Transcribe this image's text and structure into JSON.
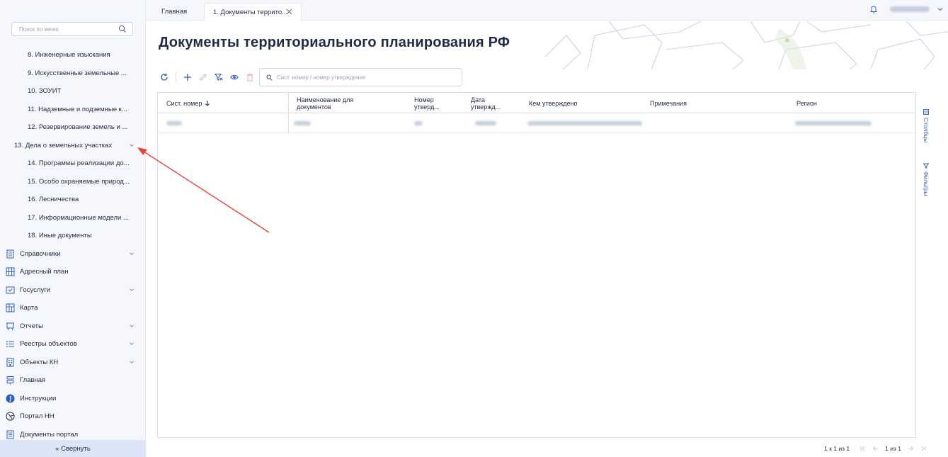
{
  "sidebar": {
    "search_placeholder": "Поиск по меню",
    "sub_items": [
      "8. Инженерные изыскания",
      "9. Искусственные земельные ...",
      "10. ЗОУИТ",
      "11. Надземные и подземные к...",
      "12. Резервирование земель и ..."
    ],
    "group_item": "13. Дела о земельных участках",
    "sub_items_after": [
      "14. Программы реализации до...",
      "15. Особо охраняемые природ...",
      "16. Лесничества",
      "17. Информационные модели ...",
      "18. Иные документы"
    ],
    "top_items": [
      {
        "label": "Справочники",
        "icon": "book-icon",
        "chevron": true
      },
      {
        "label": "Адресный план",
        "icon": "map-grid-icon",
        "chevron": false
      },
      {
        "label": "Госуслуги",
        "icon": "inbox-check-icon",
        "chevron": true
      },
      {
        "label": "Карта",
        "icon": "map-icon",
        "chevron": false
      },
      {
        "label": "Отчеты",
        "icon": "presentation-icon",
        "chevron": true
      },
      {
        "label": "Реестры объектов",
        "icon": "list-icon",
        "chevron": true
      },
      {
        "label": "Объекты КН",
        "icon": "building-icon",
        "chevron": true
      },
      {
        "label": "Главная",
        "icon": "server-icon",
        "chevron": false
      },
      {
        "label": "Инструкции",
        "icon": "info-icon",
        "chevron": false
      },
      {
        "label": "Портал НН",
        "icon": "portal-icon",
        "chevron": false
      },
      {
        "label": "Документы портал",
        "icon": "document-icon",
        "chevron": false
      }
    ],
    "collapse_label": "« Свернуть"
  },
  "tabs": {
    "home": "Главная",
    "active": "1. Документы террито..."
  },
  "page": {
    "title": "Документы территориального планирования РФ"
  },
  "grid": {
    "search_placeholder": "Сист. номер / номер утверждения",
    "columns": [
      {
        "label": "Сист. номер",
        "sorted": "desc"
      },
      {
        "label": "Наименование для документов"
      },
      {
        "label": "Номер утверд..."
      },
      {
        "label": "Дата утвержд..."
      },
      {
        "label": "Кем утверждено"
      },
      {
        "label": "Примечания"
      },
      {
        "label": "Регион"
      }
    ]
  },
  "side_panel": {
    "columns_label": "Столбцы",
    "filters_label": "Фильтры"
  },
  "pager": {
    "range": "1 к 1 из 1",
    "page": "1 из 1"
  },
  "colors": {
    "accent": "#2c5db8",
    "annotation_arrow": "#e8463a",
    "sidebar_bg": "#f5f7fc",
    "collapse_bg": "#dbe5f7"
  }
}
